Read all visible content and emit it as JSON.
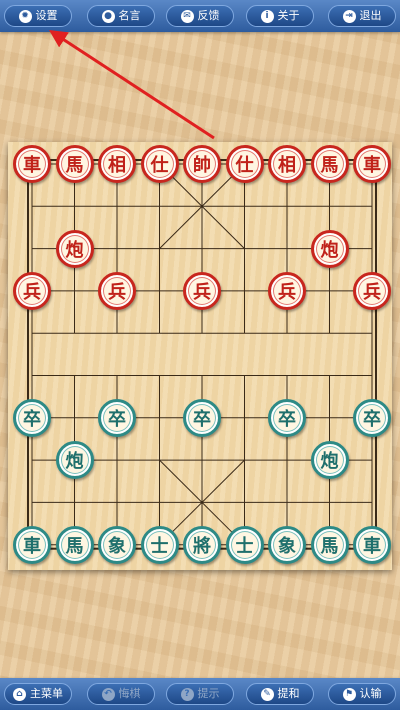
{
  "top_toolbar": {
    "buttons": [
      {
        "label": "设置",
        "icon": "gear-icon"
      },
      {
        "label": "名言",
        "icon": "speech-bubble-icon"
      },
      {
        "label": "反馈",
        "icon": "mail-icon"
      },
      {
        "label": "关于",
        "icon": "info-icon"
      },
      {
        "label": "退出",
        "icon": "exit-icon"
      }
    ]
  },
  "bottom_toolbar": {
    "buttons": [
      {
        "label": "主菜单",
        "icon": "home-icon",
        "enabled": true
      },
      {
        "label": "悔棋",
        "icon": "undo-icon",
        "enabled": false
      },
      {
        "label": "提示",
        "icon": "hint-icon",
        "enabled": false
      },
      {
        "label": "提和",
        "icon": "draw-icon",
        "enabled": true
      },
      {
        "label": "认输",
        "icon": "flag-icon",
        "enabled": true
      }
    ]
  },
  "board": {
    "river_text": "",
    "pieces": [
      {
        "ch": "車",
        "side": "red",
        "col": 0,
        "row": 0
      },
      {
        "ch": "馬",
        "side": "red",
        "col": 1,
        "row": 0
      },
      {
        "ch": "相",
        "side": "red",
        "col": 2,
        "row": 0
      },
      {
        "ch": "仕",
        "side": "red",
        "col": 3,
        "row": 0
      },
      {
        "ch": "帥",
        "side": "red",
        "col": 4,
        "row": 0
      },
      {
        "ch": "仕",
        "side": "red",
        "col": 5,
        "row": 0
      },
      {
        "ch": "相",
        "side": "red",
        "col": 6,
        "row": 0
      },
      {
        "ch": "馬",
        "side": "red",
        "col": 7,
        "row": 0
      },
      {
        "ch": "車",
        "side": "red",
        "col": 8,
        "row": 0
      },
      {
        "ch": "炮",
        "side": "red",
        "col": 1,
        "row": 2
      },
      {
        "ch": "炮",
        "side": "red",
        "col": 7,
        "row": 2
      },
      {
        "ch": "兵",
        "side": "red",
        "col": 0,
        "row": 3
      },
      {
        "ch": "兵",
        "side": "red",
        "col": 2,
        "row": 3
      },
      {
        "ch": "兵",
        "side": "red",
        "col": 4,
        "row": 3
      },
      {
        "ch": "兵",
        "side": "red",
        "col": 6,
        "row": 3
      },
      {
        "ch": "兵",
        "side": "red",
        "col": 8,
        "row": 3
      },
      {
        "ch": "卒",
        "side": "green",
        "col": 0,
        "row": 6
      },
      {
        "ch": "卒",
        "side": "green",
        "col": 2,
        "row": 6
      },
      {
        "ch": "卒",
        "side": "green",
        "col": 4,
        "row": 6
      },
      {
        "ch": "卒",
        "side": "green",
        "col": 6,
        "row": 6
      },
      {
        "ch": "卒",
        "side": "green",
        "col": 8,
        "row": 6
      },
      {
        "ch": "炮",
        "side": "green",
        "col": 1,
        "row": 7
      },
      {
        "ch": "炮",
        "side": "green",
        "col": 7,
        "row": 7
      },
      {
        "ch": "車",
        "side": "green",
        "col": 0,
        "row": 9
      },
      {
        "ch": "馬",
        "side": "green",
        "col": 1,
        "row": 9
      },
      {
        "ch": "象",
        "side": "green",
        "col": 2,
        "row": 9
      },
      {
        "ch": "士",
        "side": "green",
        "col": 3,
        "row": 9
      },
      {
        "ch": "將",
        "side": "green",
        "col": 4,
        "row": 9
      },
      {
        "ch": "士",
        "side": "green",
        "col": 5,
        "row": 9
      },
      {
        "ch": "象",
        "side": "green",
        "col": 6,
        "row": 9
      },
      {
        "ch": "馬",
        "side": "green",
        "col": 7,
        "row": 9
      },
      {
        "ch": "車",
        "side": "green",
        "col": 8,
        "row": 9
      }
    ]
  },
  "annotation": {
    "type": "arrow",
    "color": "#e02020",
    "points_to": "settings-button"
  },
  "colors": {
    "toolbar": "#2e5c9e",
    "red_piece": "#c0221a",
    "green_piece": "#1f6f6c",
    "board": "#f1d8a8"
  }
}
